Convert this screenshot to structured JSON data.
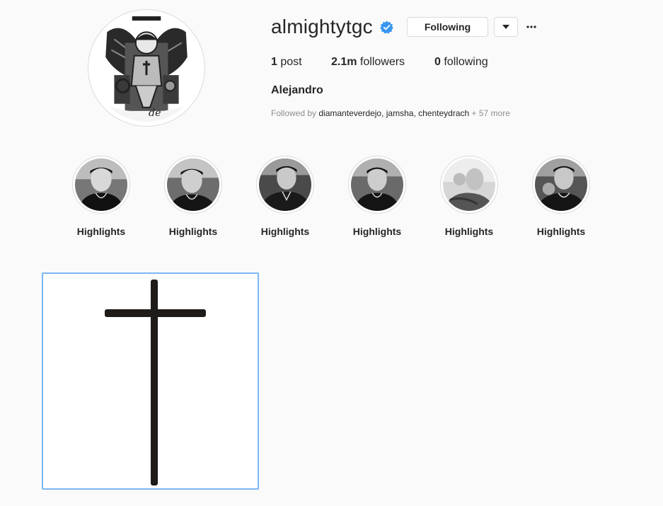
{
  "profile": {
    "username": "almightytgc",
    "full_name": "Alejandro",
    "verified_icon": "verified-badge-icon",
    "verified_color": "#3897f0"
  },
  "actions": {
    "following_label": "Following",
    "dropdown_icon": "caret-down-icon",
    "more_icon": "ellipsis-icon"
  },
  "stats": {
    "posts_count": "1",
    "posts_label": "post",
    "followers_count": "2.1m",
    "followers_label": "followers",
    "following_count": "0",
    "following_label": "following"
  },
  "followed_by": {
    "prefix": "Followed by",
    "names": "diamanteverdejo, jamsha, chenteydrach",
    "more": "+ 57 more"
  },
  "highlights": [
    {
      "label": "Highlights"
    },
    {
      "label": "Highlights"
    },
    {
      "label": "Highlights"
    },
    {
      "label": "Highlights"
    },
    {
      "label": "Highlights"
    },
    {
      "label": "Highlights"
    }
  ],
  "posts": [
    {
      "image": "cross-image"
    }
  ],
  "colors": {
    "background": "#fafafa",
    "text": "#262626",
    "muted": "#8e8e8e",
    "border": "#dbdbdb",
    "selection": "#7cb7f2"
  }
}
